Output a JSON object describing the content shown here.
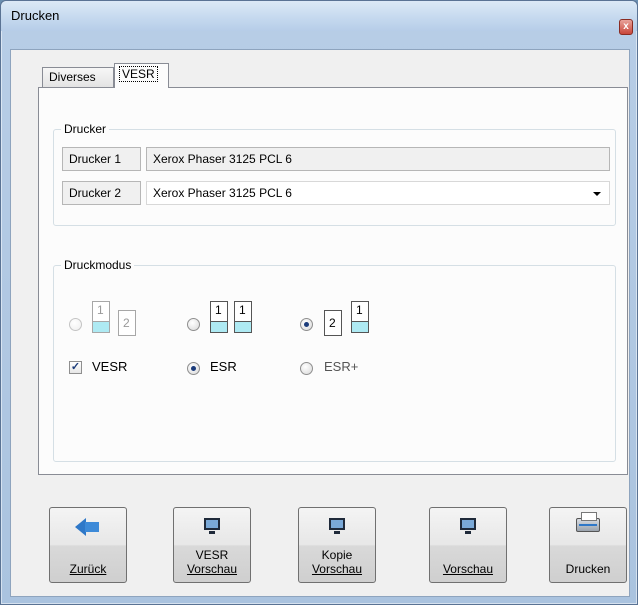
{
  "window": {
    "title": "Drucken",
    "close_label": "x"
  },
  "tabs": [
    {
      "label": "Diverses"
    },
    {
      "label": "VESR"
    }
  ],
  "printer_group": {
    "legend": "Drucker",
    "rows": [
      {
        "label": "Drucker 1",
        "value": "Xerox Phaser 3125 PCL 6"
      },
      {
        "label": "Drucker 2",
        "value": "Xerox Phaser 3125 PCL 6"
      }
    ]
  },
  "mode_group": {
    "legend": "Druckmodus",
    "layouts": [
      {
        "pages": [
          "1",
          "2"
        ],
        "selected": false,
        "enabled": false
      },
      {
        "pages": [
          "1",
          "1"
        ],
        "selected": false,
        "enabled": true
      },
      {
        "pages": [
          "2",
          "1"
        ],
        "selected": true,
        "enabled": true
      }
    ],
    "vesr_label": "VESR",
    "esr_label": "ESR",
    "esrplus_label": "ESR+"
  },
  "buttons": {
    "back_label": "Zurück",
    "vesr_preview_line1": "VESR",
    "vesr_preview_line2": "Vorschau",
    "copy_preview_line1": "Kopie",
    "copy_preview_line2": "Vorschau",
    "preview_label": "Vorschau",
    "print_label": "Drucken"
  }
}
